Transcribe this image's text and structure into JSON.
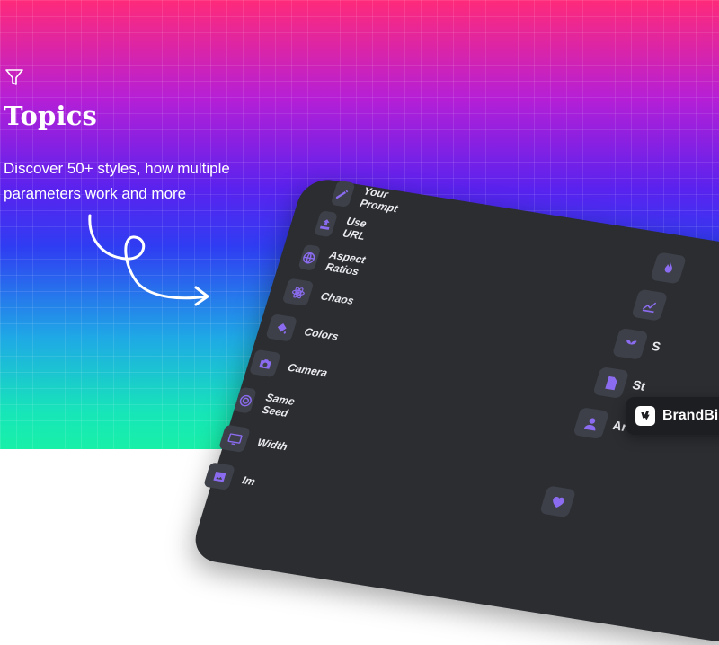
{
  "hero": {
    "title": "Topics",
    "subtitle": "Discover 50+ styles, how multiple parameters work and more",
    "icon": "filter-icon"
  },
  "panel": {
    "items": [
      {
        "label": "Your Prompt",
        "icon": "edit-icon"
      },
      {
        "label": "Use URL",
        "icon": "upload-icon"
      },
      {
        "label": "Aspect Ratios",
        "icon": "globe-icon"
      },
      {
        "label": "Chaos",
        "icon": "atom-icon"
      },
      {
        "label": "Colors",
        "icon": "paint-bucket-icon"
      },
      {
        "label": "Camera",
        "icon": "camera-icon"
      },
      {
        "label": "Same Seed",
        "icon": "target-icon"
      },
      {
        "label": "Width",
        "icon": "monitor-icon"
      },
      {
        "label": "Im",
        "icon": "image-icon"
      }
    ],
    "right_items": [
      {
        "label": "",
        "icon": "flame-icon"
      },
      {
        "label": "",
        "icon": "chart-icon"
      },
      {
        "label": "S",
        "icon": "sprout-icon"
      },
      {
        "label": "St",
        "icon": "document-icon"
      },
      {
        "label": "Ar",
        "icon": "person-icon"
      },
      {
        "label": "",
        "icon": "heart-icon"
      }
    ],
    "accent_color": "#8b6cf0",
    "background_color": "#2b2d31"
  },
  "brand": {
    "name": "BrandBir",
    "icon": "brand-logo-icon"
  }
}
